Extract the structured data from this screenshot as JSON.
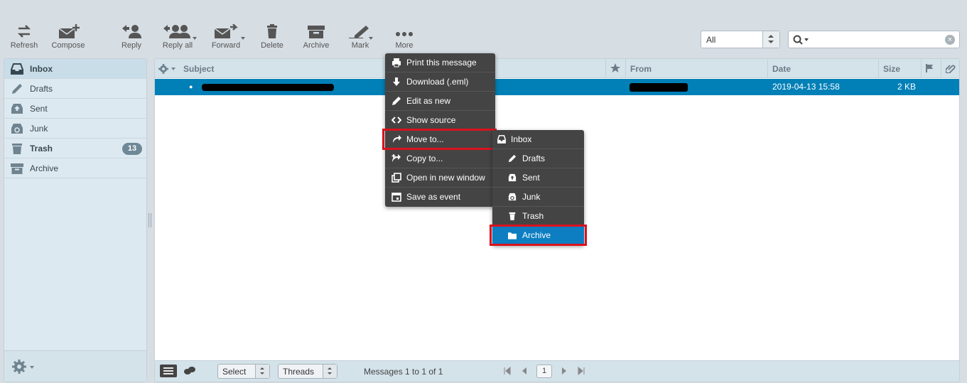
{
  "toolbar": {
    "refresh": "Refresh",
    "compose": "Compose",
    "reply": "Reply",
    "reply_all": "Reply all",
    "forward": "Forward",
    "delete": "Delete",
    "archive": "Archive",
    "mark": "Mark",
    "more": "More",
    "filter_value": "All",
    "search_value": ""
  },
  "folders": [
    {
      "label": "Inbox",
      "icon": "inbox-icon"
    },
    {
      "label": "Drafts",
      "icon": "pencil-icon"
    },
    {
      "label": "Sent",
      "icon": "sent-icon"
    },
    {
      "label": "Junk",
      "icon": "junk-icon"
    },
    {
      "label": "Trash",
      "icon": "trash-icon",
      "count": "13"
    },
    {
      "label": "Archive",
      "icon": "archive-icon"
    }
  ],
  "list": {
    "columns": {
      "subject": "Subject",
      "from": "From",
      "date": "Date",
      "size": "Size"
    },
    "rows": [
      {
        "date": "2019-04-13 15:58",
        "size": "2 KB"
      }
    ]
  },
  "footer": {
    "select": "Select",
    "threads": "Threads",
    "count_text": "Messages 1 to 1 of 1",
    "page": "1"
  },
  "more_menu": [
    {
      "label": "Print this message",
      "icon": "print-icon"
    },
    {
      "label": "Download (.eml)",
      "icon": "download-icon"
    },
    {
      "label": "Edit as new",
      "icon": "pencil-icon"
    },
    {
      "label": "Show source",
      "icon": "code-icon"
    },
    {
      "label": "Move to...",
      "icon": "move-icon"
    },
    {
      "label": "Copy to...",
      "icon": "copy-icon"
    },
    {
      "label": "Open in new window",
      "icon": "new-window-icon"
    },
    {
      "label": "Save as event",
      "icon": "calendar-icon"
    }
  ],
  "move_submenu": [
    {
      "label": "Inbox",
      "icon": "inbox-icon"
    },
    {
      "label": "Drafts",
      "icon": "pencil-icon"
    },
    {
      "label": "Sent",
      "icon": "sent-icon"
    },
    {
      "label": "Junk",
      "icon": "junk-icon"
    },
    {
      "label": "Trash",
      "icon": "trash-icon"
    },
    {
      "label": "Archive",
      "icon": "folder-icon"
    }
  ],
  "colors": {
    "accent": "#0080b7",
    "highlight_box": "#d9121e",
    "menu_bg": "#444444"
  }
}
